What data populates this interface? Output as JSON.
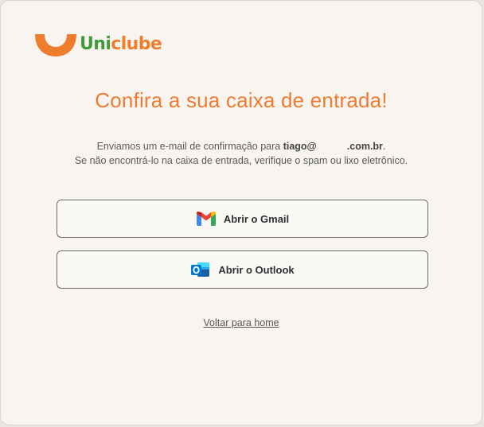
{
  "brand": {
    "name_part1": "Uni",
    "name_part2": "clube",
    "primary_color": "#ef7d2e",
    "secondary_color": "#3f9b3a"
  },
  "heading": "Confira a sua caixa de entrada!",
  "message": {
    "line1_prefix": "Enviamos um e-mail de confirmação para ",
    "email_user": "tiago@",
    "email_domain": ".com.br",
    "line1_suffix": ".",
    "line2": "Se não encontrá-lo na caixa de entrada, verifique o spam ou lixo eletrônico."
  },
  "buttons": {
    "gmail_label": "Abrir o Gmail",
    "gmail_icon": "gmail-icon",
    "outlook_label": "Abrir o Outlook",
    "outlook_icon": "outlook-icon"
  },
  "back_link": "Voltar para home"
}
